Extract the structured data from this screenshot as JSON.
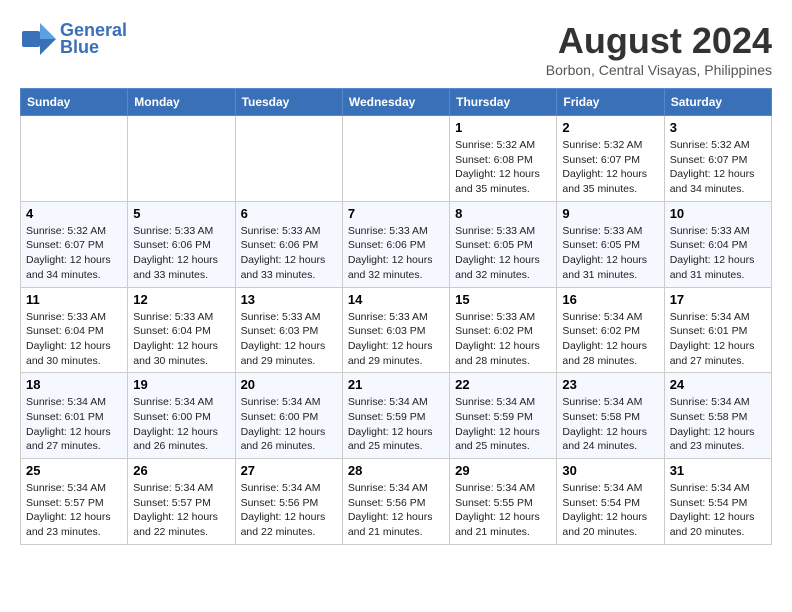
{
  "logo": {
    "line1": "General",
    "line2": "Blue"
  },
  "title": {
    "month_year": "August 2024",
    "location": "Borbon, Central Visayas, Philippines"
  },
  "weekdays": [
    "Sunday",
    "Monday",
    "Tuesday",
    "Wednesday",
    "Thursday",
    "Friday",
    "Saturday"
  ],
  "weeks": [
    [
      {
        "day": "",
        "info": ""
      },
      {
        "day": "",
        "info": ""
      },
      {
        "day": "",
        "info": ""
      },
      {
        "day": "",
        "info": ""
      },
      {
        "day": "1",
        "info": "Sunrise: 5:32 AM\nSunset: 6:08 PM\nDaylight: 12 hours\nand 35 minutes."
      },
      {
        "day": "2",
        "info": "Sunrise: 5:32 AM\nSunset: 6:07 PM\nDaylight: 12 hours\nand 35 minutes."
      },
      {
        "day": "3",
        "info": "Sunrise: 5:32 AM\nSunset: 6:07 PM\nDaylight: 12 hours\nand 34 minutes."
      }
    ],
    [
      {
        "day": "4",
        "info": "Sunrise: 5:32 AM\nSunset: 6:07 PM\nDaylight: 12 hours\nand 34 minutes."
      },
      {
        "day": "5",
        "info": "Sunrise: 5:33 AM\nSunset: 6:06 PM\nDaylight: 12 hours\nand 33 minutes."
      },
      {
        "day": "6",
        "info": "Sunrise: 5:33 AM\nSunset: 6:06 PM\nDaylight: 12 hours\nand 33 minutes."
      },
      {
        "day": "7",
        "info": "Sunrise: 5:33 AM\nSunset: 6:06 PM\nDaylight: 12 hours\nand 32 minutes."
      },
      {
        "day": "8",
        "info": "Sunrise: 5:33 AM\nSunset: 6:05 PM\nDaylight: 12 hours\nand 32 minutes."
      },
      {
        "day": "9",
        "info": "Sunrise: 5:33 AM\nSunset: 6:05 PM\nDaylight: 12 hours\nand 31 minutes."
      },
      {
        "day": "10",
        "info": "Sunrise: 5:33 AM\nSunset: 6:04 PM\nDaylight: 12 hours\nand 31 minutes."
      }
    ],
    [
      {
        "day": "11",
        "info": "Sunrise: 5:33 AM\nSunset: 6:04 PM\nDaylight: 12 hours\nand 30 minutes."
      },
      {
        "day": "12",
        "info": "Sunrise: 5:33 AM\nSunset: 6:04 PM\nDaylight: 12 hours\nand 30 minutes."
      },
      {
        "day": "13",
        "info": "Sunrise: 5:33 AM\nSunset: 6:03 PM\nDaylight: 12 hours\nand 29 minutes."
      },
      {
        "day": "14",
        "info": "Sunrise: 5:33 AM\nSunset: 6:03 PM\nDaylight: 12 hours\nand 29 minutes."
      },
      {
        "day": "15",
        "info": "Sunrise: 5:33 AM\nSunset: 6:02 PM\nDaylight: 12 hours\nand 28 minutes."
      },
      {
        "day": "16",
        "info": "Sunrise: 5:34 AM\nSunset: 6:02 PM\nDaylight: 12 hours\nand 28 minutes."
      },
      {
        "day": "17",
        "info": "Sunrise: 5:34 AM\nSunset: 6:01 PM\nDaylight: 12 hours\nand 27 minutes."
      }
    ],
    [
      {
        "day": "18",
        "info": "Sunrise: 5:34 AM\nSunset: 6:01 PM\nDaylight: 12 hours\nand 27 minutes."
      },
      {
        "day": "19",
        "info": "Sunrise: 5:34 AM\nSunset: 6:00 PM\nDaylight: 12 hours\nand 26 minutes."
      },
      {
        "day": "20",
        "info": "Sunrise: 5:34 AM\nSunset: 6:00 PM\nDaylight: 12 hours\nand 26 minutes."
      },
      {
        "day": "21",
        "info": "Sunrise: 5:34 AM\nSunset: 5:59 PM\nDaylight: 12 hours\nand 25 minutes."
      },
      {
        "day": "22",
        "info": "Sunrise: 5:34 AM\nSunset: 5:59 PM\nDaylight: 12 hours\nand 25 minutes."
      },
      {
        "day": "23",
        "info": "Sunrise: 5:34 AM\nSunset: 5:58 PM\nDaylight: 12 hours\nand 24 minutes."
      },
      {
        "day": "24",
        "info": "Sunrise: 5:34 AM\nSunset: 5:58 PM\nDaylight: 12 hours\nand 23 minutes."
      }
    ],
    [
      {
        "day": "25",
        "info": "Sunrise: 5:34 AM\nSunset: 5:57 PM\nDaylight: 12 hours\nand 23 minutes."
      },
      {
        "day": "26",
        "info": "Sunrise: 5:34 AM\nSunset: 5:57 PM\nDaylight: 12 hours\nand 22 minutes."
      },
      {
        "day": "27",
        "info": "Sunrise: 5:34 AM\nSunset: 5:56 PM\nDaylight: 12 hours\nand 22 minutes."
      },
      {
        "day": "28",
        "info": "Sunrise: 5:34 AM\nSunset: 5:56 PM\nDaylight: 12 hours\nand 21 minutes."
      },
      {
        "day": "29",
        "info": "Sunrise: 5:34 AM\nSunset: 5:55 PM\nDaylight: 12 hours\nand 21 minutes."
      },
      {
        "day": "30",
        "info": "Sunrise: 5:34 AM\nSunset: 5:54 PM\nDaylight: 12 hours\nand 20 minutes."
      },
      {
        "day": "31",
        "info": "Sunrise: 5:34 AM\nSunset: 5:54 PM\nDaylight: 12 hours\nand 20 minutes."
      }
    ]
  ]
}
